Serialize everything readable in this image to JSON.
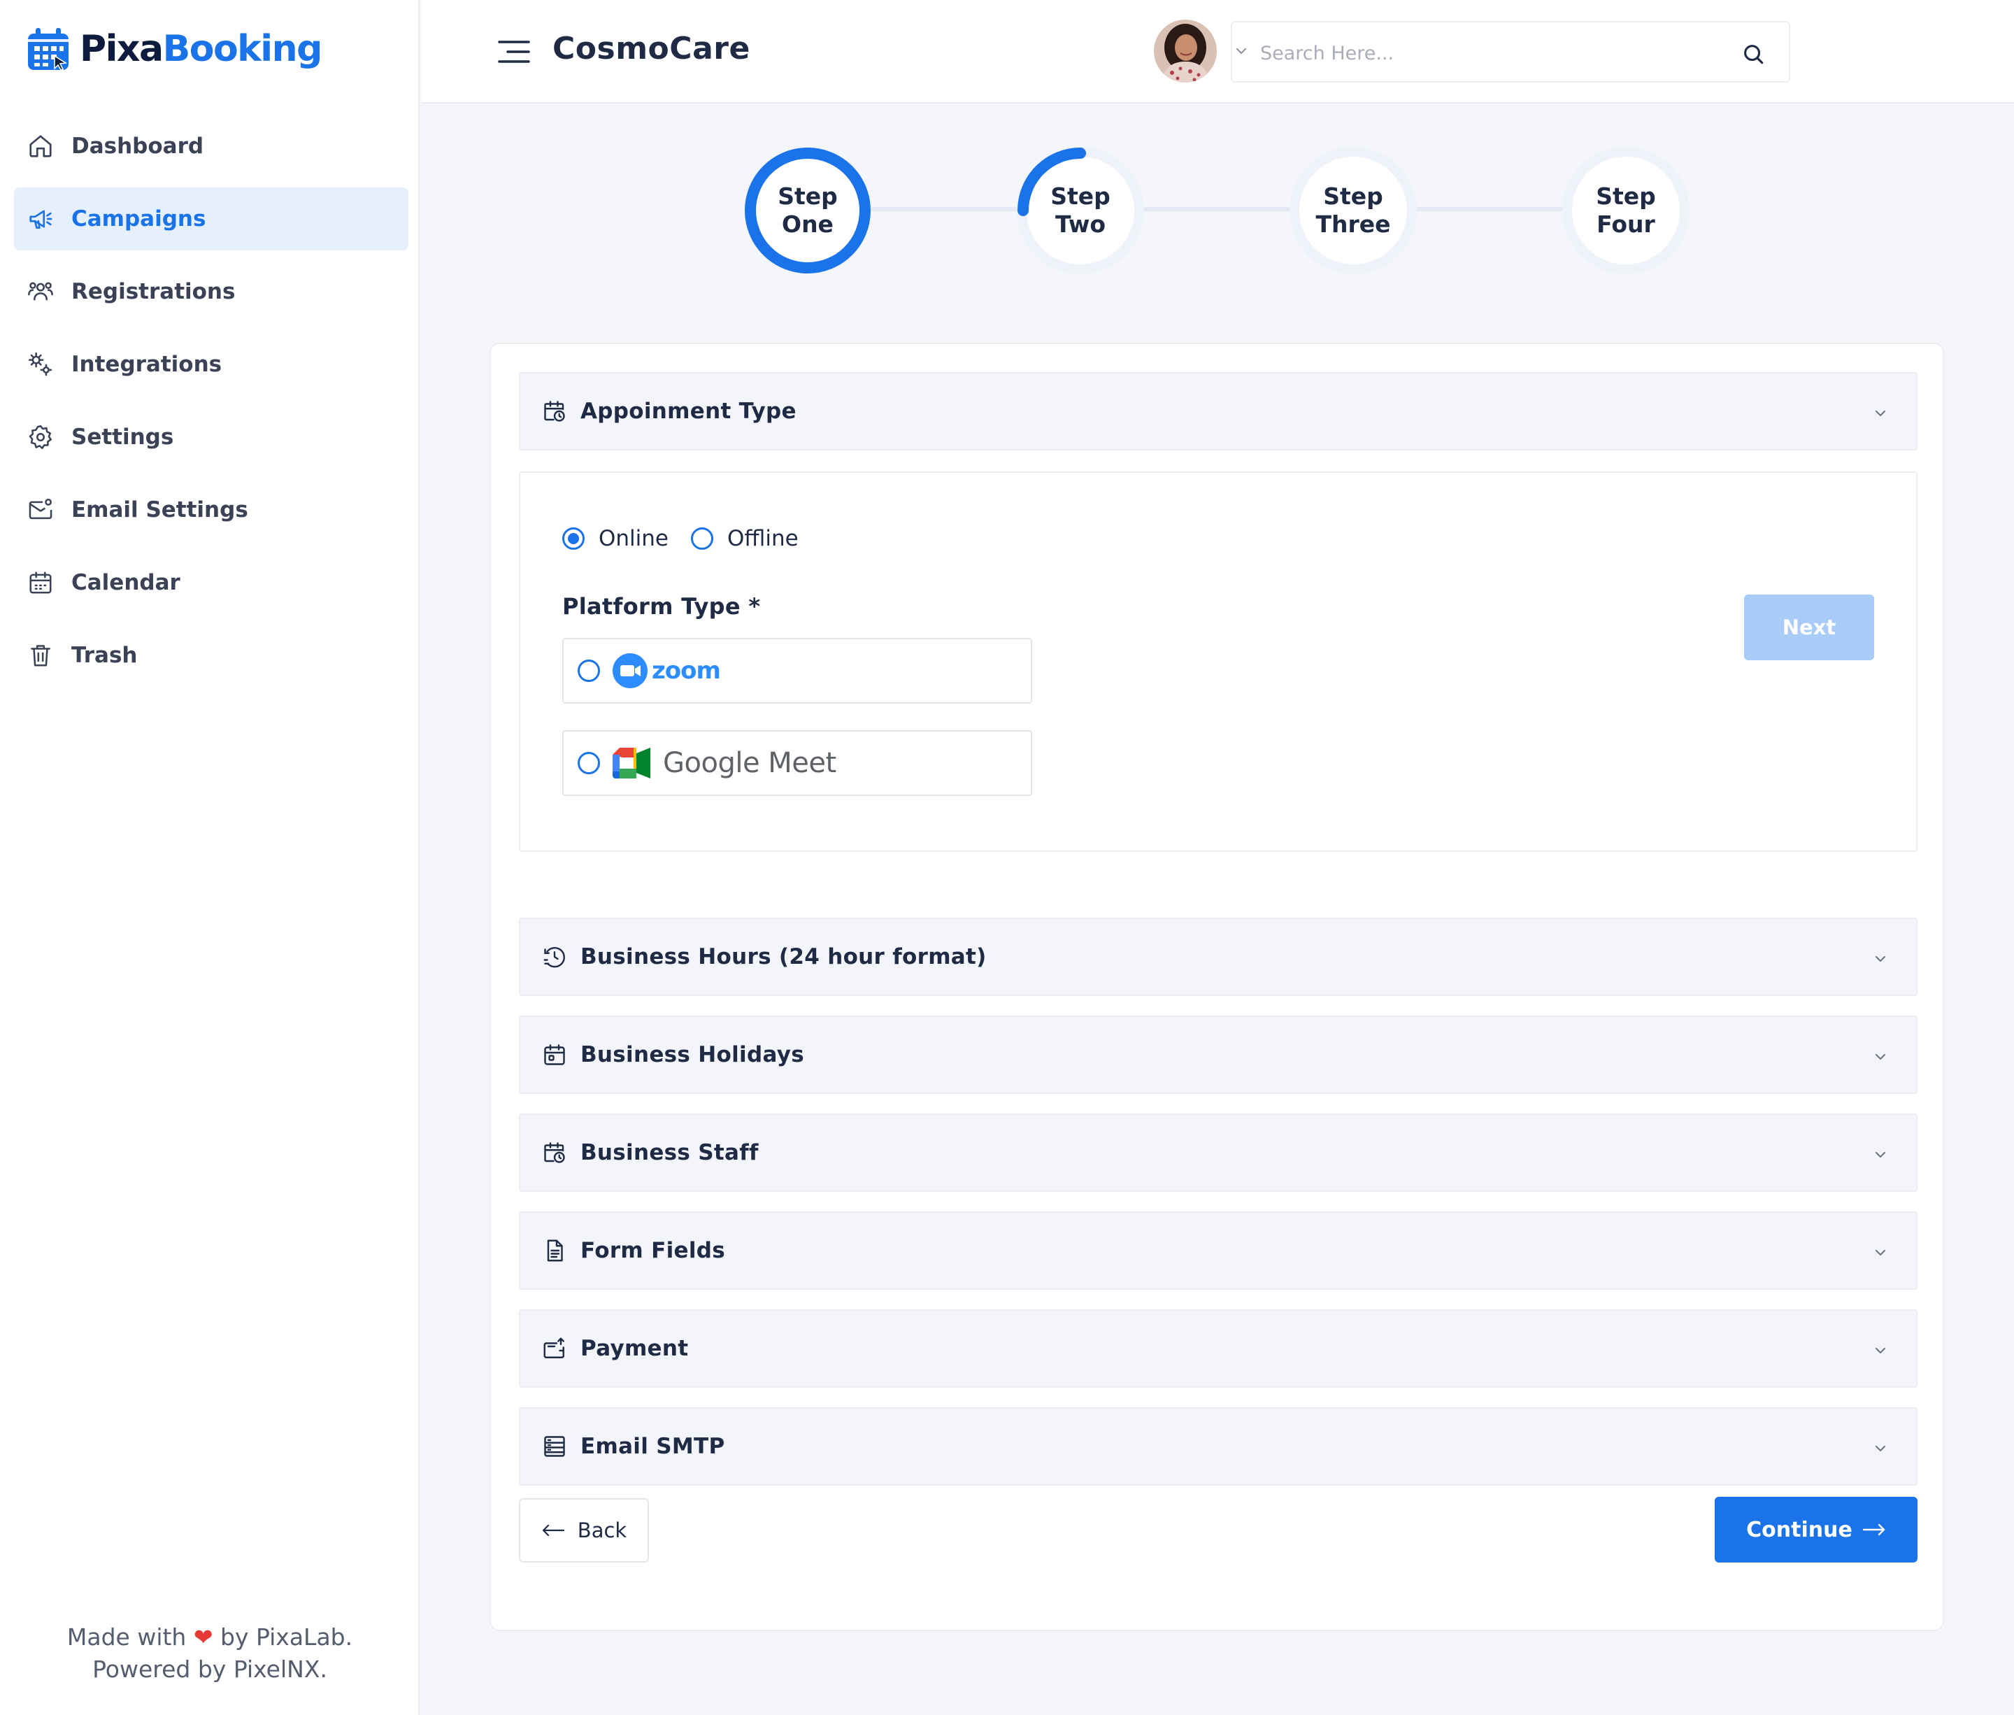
{
  "brand": {
    "part1": "Pixa",
    "part2": "Booking"
  },
  "sidebar": {
    "items": [
      {
        "label": "Dashboard",
        "icon": "home-icon",
        "active": false
      },
      {
        "label": "Campaigns",
        "icon": "megaphone-icon",
        "active": true
      },
      {
        "label": "Registrations",
        "icon": "users-icon",
        "active": false
      },
      {
        "label": "Integrations",
        "icon": "integrations-icon",
        "active": false
      },
      {
        "label": "Settings",
        "icon": "gear-icon",
        "active": false
      },
      {
        "label": "Email Settings",
        "icon": "mail-settings-icon",
        "active": false
      },
      {
        "label": "Calendar",
        "icon": "calendar-icon",
        "active": false
      },
      {
        "label": "Trash",
        "icon": "trash-icon",
        "active": false
      }
    ],
    "footer": {
      "line1_a": "Made with",
      "line1_b": "by PixaLab.",
      "line2": "Powered by PixelNX."
    }
  },
  "header": {
    "title": "CosmoCare",
    "search_placeholder": "Search Here..."
  },
  "stepper": {
    "steps": [
      {
        "word": "Step",
        "num": "One",
        "progress": 1.0
      },
      {
        "word": "Step",
        "num": "Two",
        "progress": 0.25
      },
      {
        "word": "Step",
        "num": "Three",
        "progress": 0
      },
      {
        "word": "Step",
        "num": "Four",
        "progress": 0
      }
    ]
  },
  "appointment": {
    "title": "Appoinment Type",
    "mode_options": [
      "Online",
      "Offline"
    ],
    "selected_mode": "Online",
    "platform_label": "Platform Type *",
    "platforms": [
      {
        "name": "zoom",
        "logo_text": "zoom"
      },
      {
        "name": "google-meet",
        "logo_text": "Google Meet"
      }
    ],
    "next_label": "Next"
  },
  "sections": [
    {
      "title": "Business Hours (24 hour format)",
      "icon": "clock-history-icon"
    },
    {
      "title": "Business Holidays",
      "icon": "calendar-holiday-icon"
    },
    {
      "title": "Business Staff",
      "icon": "calendar-clock-icon"
    },
    {
      "title": "Form Fields",
      "icon": "document-icon"
    },
    {
      "title": "Payment",
      "icon": "wallet-icon"
    },
    {
      "title": "Email SMTP",
      "icon": "server-icon"
    }
  ],
  "actions": {
    "back_label": "Back",
    "continue_label": "Continue"
  },
  "colors": {
    "primary": "#1a73e8",
    "primary_light": "#a8cbf8",
    "active_bg": "#e6f0fd"
  }
}
